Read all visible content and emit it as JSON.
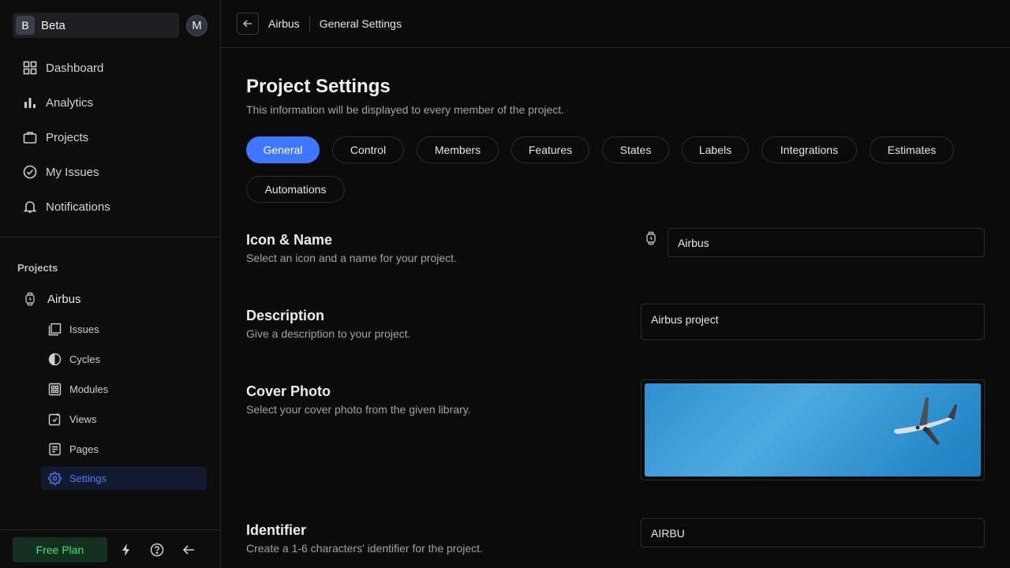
{
  "workspace": {
    "initial": "B",
    "name": "Beta",
    "user_initial": "M"
  },
  "nav": {
    "items": [
      {
        "label": "Dashboard",
        "icon": "grid-icon"
      },
      {
        "label": "Analytics",
        "icon": "bar-chart-icon"
      },
      {
        "label": "Projects",
        "icon": "briefcase-icon"
      },
      {
        "label": "My Issues",
        "icon": "check-circle-icon"
      },
      {
        "label": "Notifications",
        "icon": "bell-icon"
      }
    ]
  },
  "projects_section": {
    "heading": "Projects",
    "project_name": "Airbus",
    "subitems": [
      {
        "label": "Issues",
        "icon": "layers-icon"
      },
      {
        "label": "Cycles",
        "icon": "contrast-icon"
      },
      {
        "label": "Modules",
        "icon": "modules-grid-icon"
      },
      {
        "label": "Views",
        "icon": "views-icon"
      },
      {
        "label": "Pages",
        "icon": "page-icon"
      },
      {
        "label": "Settings",
        "icon": "gear-icon",
        "active": true
      }
    ]
  },
  "bottom": {
    "free_plan_label": "Free Plan"
  },
  "header": {
    "crumb_project": "Airbus",
    "crumb_page": "General Settings"
  },
  "main": {
    "title": "Project Settings",
    "subtitle": "This information will be displayed to every member of the project.",
    "tabs": [
      {
        "label": "General",
        "active": true
      },
      {
        "label": "Control"
      },
      {
        "label": "Members"
      },
      {
        "label": "Features"
      },
      {
        "label": "States"
      },
      {
        "label": "Labels"
      },
      {
        "label": "Integrations"
      },
      {
        "label": "Estimates"
      },
      {
        "label": "Automations"
      }
    ],
    "sections": {
      "icon_name": {
        "title": "Icon & Name",
        "subtitle": "Select an icon and a name for your project.",
        "value": "Airbus"
      },
      "description": {
        "title": "Description",
        "subtitle": "Give a description to your project.",
        "value": "Airbus project"
      },
      "cover": {
        "title": "Cover Photo",
        "subtitle": "Select your cover photo from the given library."
      },
      "identifier": {
        "title": "Identifier",
        "subtitle": "Create a 1-6 characters' identifier for the project.",
        "value": "AIRBU"
      }
    }
  },
  "colors": {
    "accent": "#3f76ff",
    "free_plan_text": "#4ade80"
  }
}
